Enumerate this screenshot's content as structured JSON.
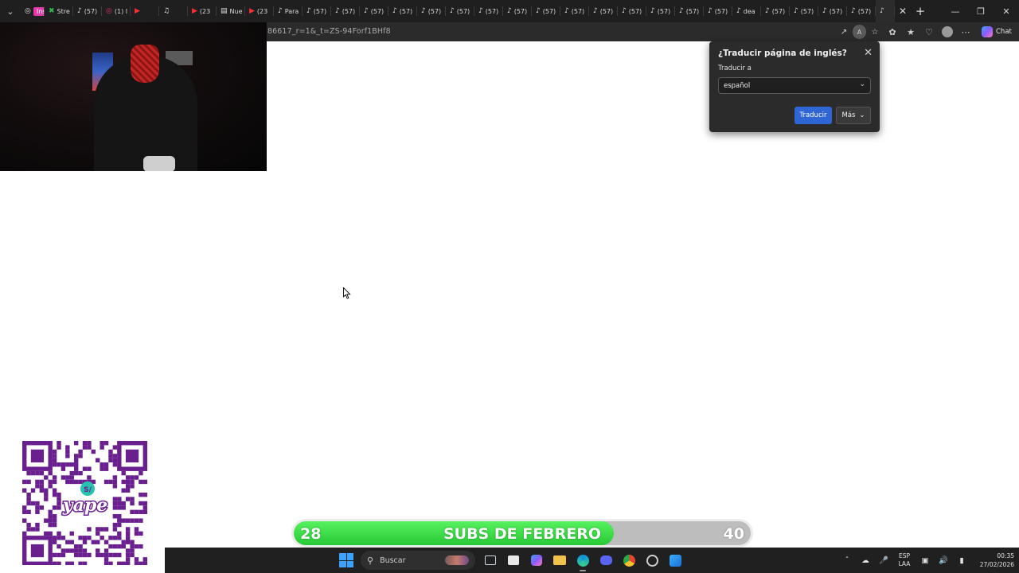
{
  "tabs": [
    {
      "icon": "instagram-icon",
      "label": "",
      "badge": "Insta",
      "style": "first"
    },
    {
      "icon": "x-icon",
      "label": "Stre",
      "style": "green"
    },
    {
      "icon": "tiktok-icon",
      "label": "(57)"
    },
    {
      "icon": "instagram-icon",
      "label": "(1) I",
      "style": "insta2"
    },
    {
      "icon": "youtube-icon",
      "label": "",
      "style": "youtube"
    },
    {
      "icon": "speaker-icon",
      "label": ""
    },
    {
      "icon": "youtube-icon",
      "label": "(23",
      "style": "youtube"
    },
    {
      "icon": "news-icon",
      "label": "Nue"
    },
    {
      "icon": "youtube-icon",
      "label": "(23",
      "style": "youtube"
    },
    {
      "icon": "tiktok-icon",
      "label": "Para"
    },
    {
      "icon": "tiktok-icon",
      "label": "(57)"
    },
    {
      "icon": "tiktok-icon",
      "label": "(57)"
    },
    {
      "icon": "tiktok-icon",
      "label": "(57)"
    },
    {
      "icon": "tiktok-icon",
      "label": "(57)"
    },
    {
      "icon": "tiktok-icon",
      "label": "(57)"
    },
    {
      "icon": "tiktok-icon",
      "label": "(57)"
    },
    {
      "icon": "tiktok-icon",
      "label": "(57)"
    },
    {
      "icon": "tiktok-icon",
      "label": "(57)"
    },
    {
      "icon": "tiktok-icon",
      "label": "(57)"
    },
    {
      "icon": "tiktok-icon",
      "label": "(57)"
    },
    {
      "icon": "tiktok-icon",
      "label": "(57)"
    },
    {
      "icon": "tiktok-icon",
      "label": "(57)"
    },
    {
      "icon": "tiktok-icon",
      "label": "(57)"
    },
    {
      "icon": "tiktok-icon",
      "label": "(57)"
    },
    {
      "icon": "tiktok-icon",
      "label": "(57)"
    },
    {
      "icon": "tiktok-icon",
      "label": "dea"
    },
    {
      "icon": "tiktok-icon",
      "label": "(57)"
    },
    {
      "icon": "tiktok-icon",
      "label": "(57)"
    },
    {
      "icon": "tiktok-icon",
      "label": "(57)"
    },
    {
      "icon": "tiktok-icon",
      "label": "(57)"
    },
    {
      "icon": "tiktok-icon",
      "label": "",
      "style": "active"
    }
  ],
  "address_bar": {
    "url_fragment": "86617_r=1&_t=ZS-94Forf1BHf8"
  },
  "copilot_label": "Chat",
  "translate_popup": {
    "title": "¿Traducir página de inglés?",
    "translate_to_label": "Traducir a",
    "selected_language": "español",
    "primary_button": "Traducir",
    "more_button": "Más"
  },
  "subs_goal": {
    "current": "28",
    "goal": "40",
    "label": "SUBS DE FEBRERO",
    "progress_fraction": 0.7
  },
  "taskbar": {
    "search_placeholder": "Buscar",
    "language_top": "ESP",
    "language_bottom": "LAA",
    "time": "00:35",
    "date": "27/02/2026"
  },
  "qr_card": {
    "brand": "yape",
    "currency_badge": "S/"
  },
  "colors": {
    "progress_fill": "#27c934",
    "translate_primary": "#2f66d6",
    "qr_purple": "#6a1f8f"
  }
}
